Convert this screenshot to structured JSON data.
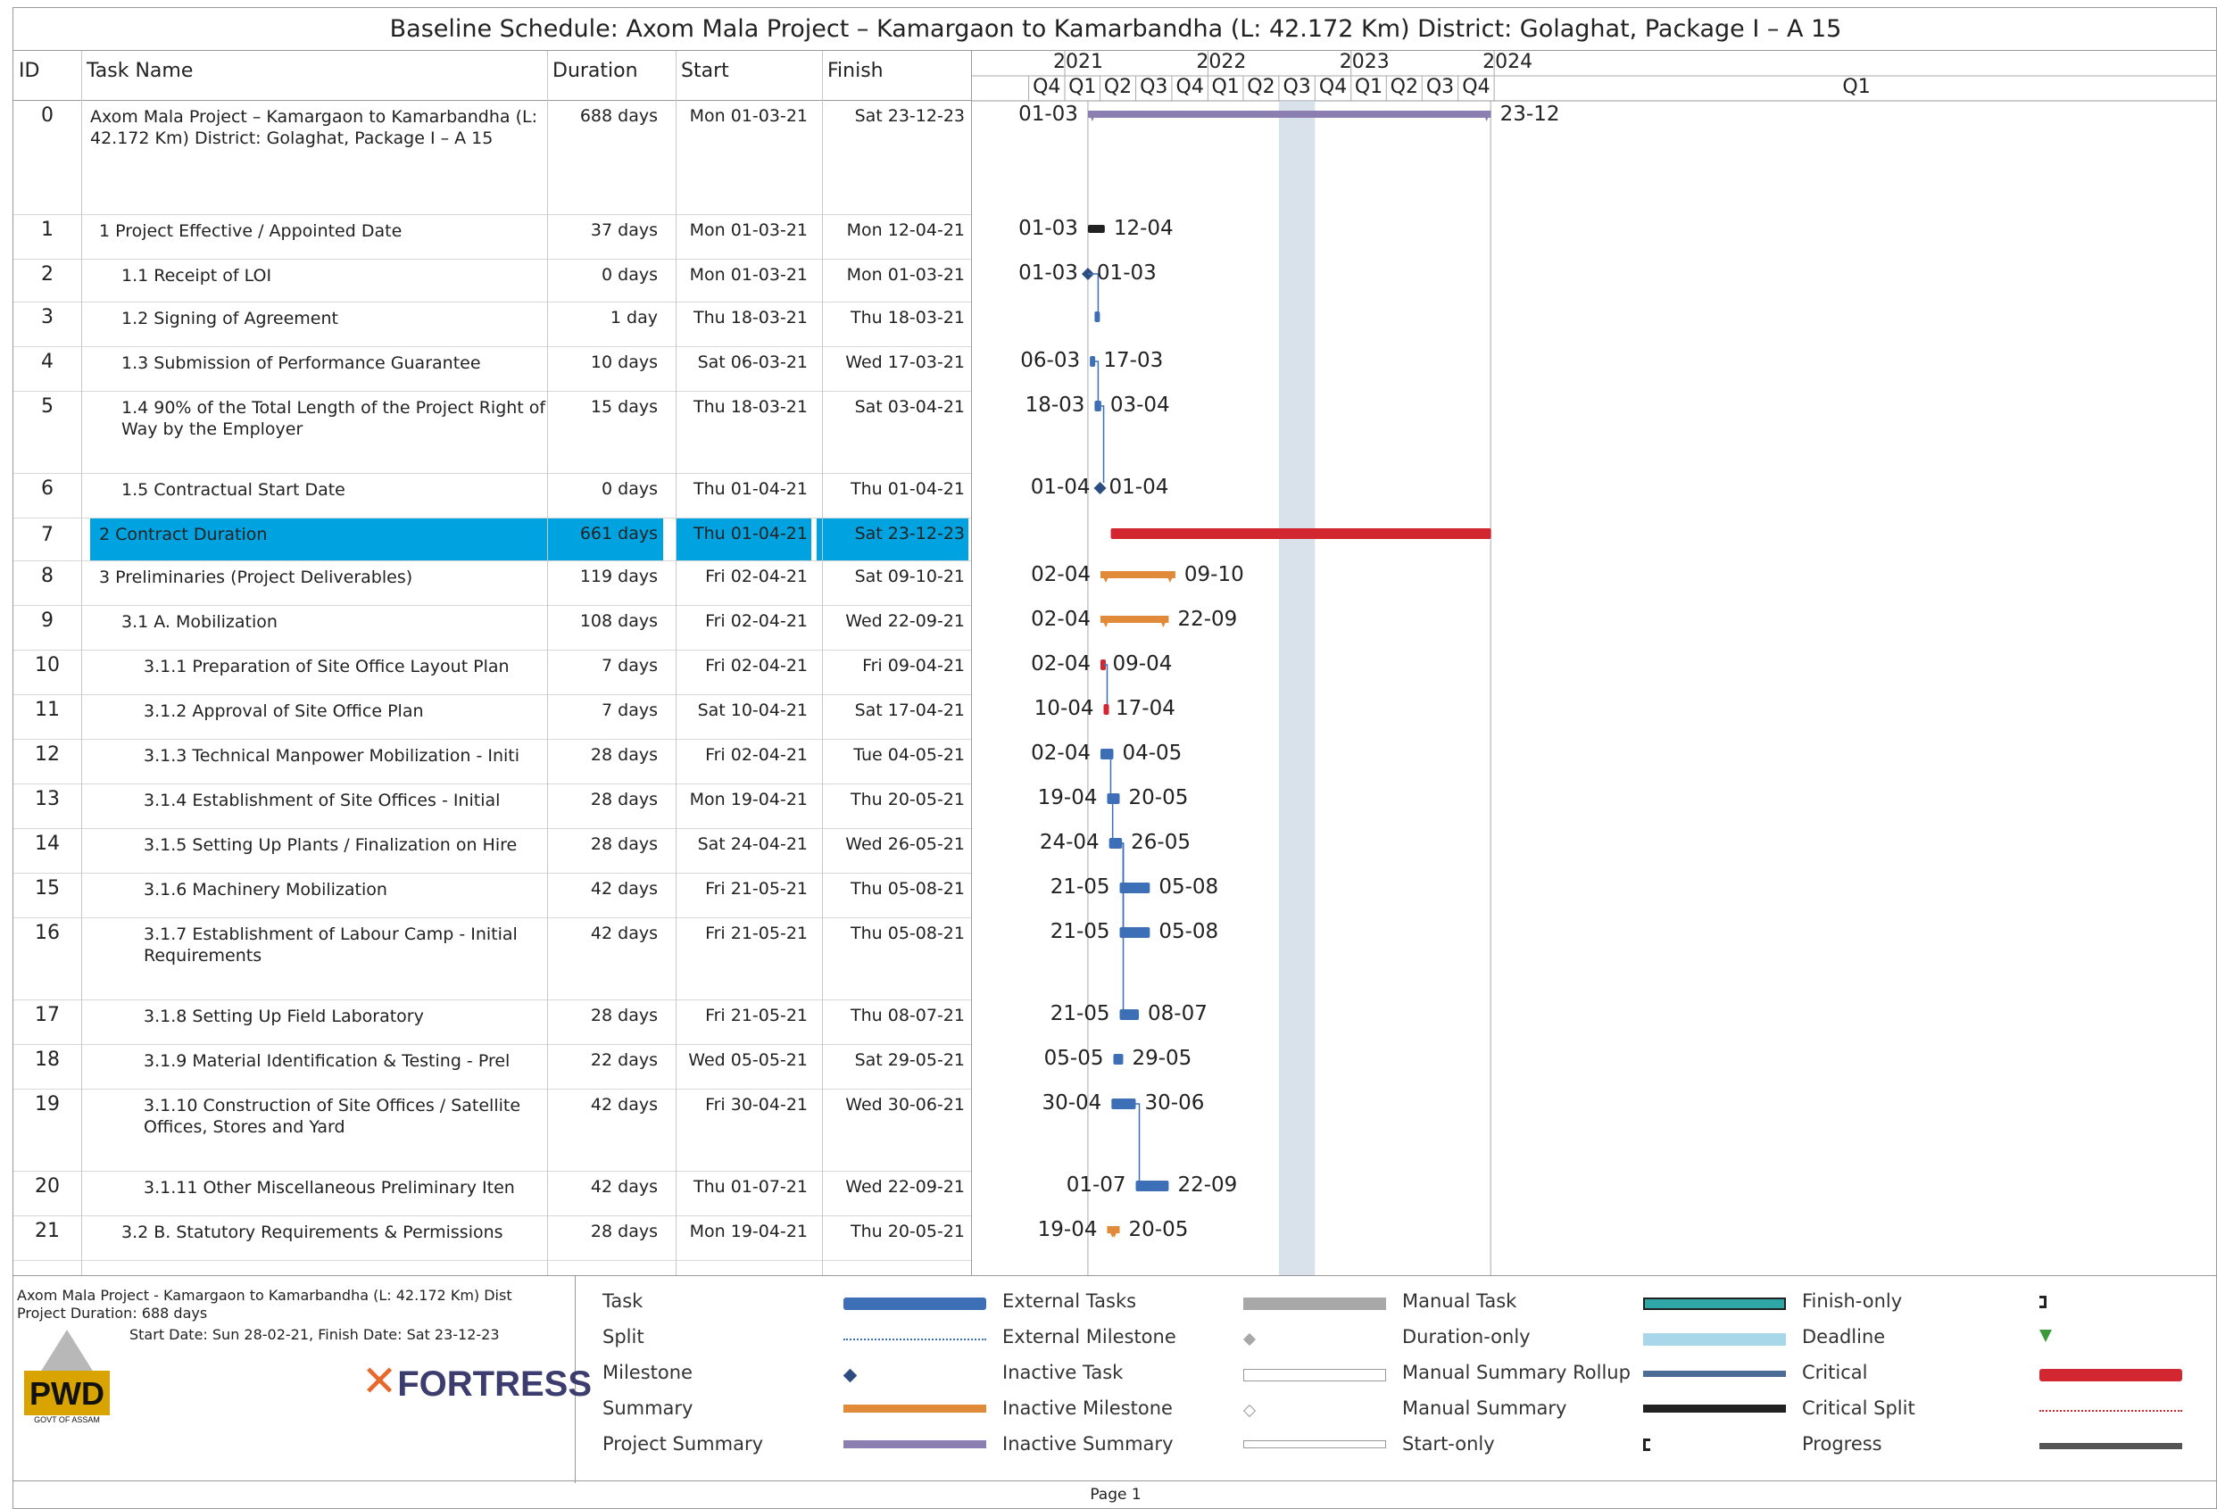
{
  "title": "Baseline Schedule: Axom Mala Project – Kamargaon to Kamarbandha (L: 42.172 Km) District: Golaghat, Package I – A 15",
  "columns": {
    "id": "ID",
    "name": "Task Name",
    "duration": "Duration",
    "start": "Start",
    "finish": "Finish"
  },
  "timescale": {
    "years": [
      "2021",
      "2022",
      "2023",
      "2024"
    ],
    "quarters": [
      "Q4",
      "Q1",
      "Q2",
      "Q3",
      "Q4",
      "Q1",
      "Q2",
      "Q3",
      "Q4",
      "Q1",
      "Q2",
      "Q3",
      "Q4",
      "Q1"
    ]
  },
  "tasks": [
    {
      "id": "0",
      "name": "Axom Mala Project – Kamargaon to Kamarbandha (L: 42.172 Km) District: Golaghat, Package I – A 15",
      "duration": "688 days",
      "start": "Mon 01-03-21",
      "finish": "Sat 23-12-23",
      "type": "project-summary",
      "label_start": "01-03",
      "label_finish": "23-12"
    },
    {
      "id": "1",
      "name": "1 Project Effective / Appointed Date",
      "duration": "37 days",
      "start": "Mon 01-03-21",
      "finish": "Mon 12-04-21",
      "type": "manual-summary",
      "label_start": "01-03",
      "label_finish": "12-04"
    },
    {
      "id": "2",
      "name": "1.1 Receipt of LOI",
      "duration": "0 days",
      "start": "Mon 01-03-21",
      "finish": "Mon 01-03-21",
      "type": "milestone",
      "label_start": "01-03",
      "label_finish": "01-03"
    },
    {
      "id": "3",
      "name": "1.2 Signing of Agreement",
      "duration": "1 day",
      "start": "Thu 18-03-21",
      "finish": "Thu 18-03-21",
      "type": "task",
      "label_start": "",
      "label_finish": ""
    },
    {
      "id": "4",
      "name": "1.3 Submission of Performance Guarantee",
      "duration": "10 days",
      "start": "Sat 06-03-21",
      "finish": "Wed 17-03-21",
      "type": "task",
      "label_start": "06-03",
      "label_finish": "17-03"
    },
    {
      "id": "5",
      "name": "1.4 90% of the Total Length of the Project Right of Way by the Employer",
      "duration": "15 days",
      "start": "Thu 18-03-21",
      "finish": "Sat 03-04-21",
      "type": "task",
      "label_start": "18-03",
      "label_finish": "03-04"
    },
    {
      "id": "6",
      "name": "1.5 Contractual Start Date",
      "duration": "0 days",
      "start": "Thu 01-04-21",
      "finish": "Thu 01-04-21",
      "type": "milestone",
      "label_start": "01-04",
      "label_finish": "01-04"
    },
    {
      "id": "7",
      "name": "2 Contract Duration",
      "duration": "661 days",
      "start": "Thu 01-04-21",
      "finish": "Sat 23-12-23",
      "type": "critical",
      "label_start": "",
      "label_finish": ""
    },
    {
      "id": "8",
      "name": "3 Preliminaries (Project Deliverables)",
      "duration": "119 days",
      "start": "Fri 02-04-21",
      "finish": "Sat 09-10-21",
      "type": "summary",
      "label_start": "02-04",
      "label_finish": "09-10"
    },
    {
      "id": "9",
      "name": "3.1 A. Mobilization",
      "duration": "108 days",
      "start": "Fri 02-04-21",
      "finish": "Wed 22-09-21",
      "type": "summary",
      "label_start": "02-04",
      "label_finish": "22-09"
    },
    {
      "id": "10",
      "name": "3.1.1 Preparation of Site Office Layout Plan",
      "duration": "7 days",
      "start": "Fri 02-04-21",
      "finish": "Fri 09-04-21",
      "type": "critical-task",
      "label_start": "02-04",
      "label_finish": "09-04"
    },
    {
      "id": "11",
      "name": "3.1.2 Approval of Site Office Plan",
      "duration": "7 days",
      "start": "Sat 10-04-21",
      "finish": "Sat 17-04-21",
      "type": "critical-task",
      "label_start": "10-04",
      "label_finish": "17-04"
    },
    {
      "id": "12",
      "name": "3.1.3 Technical Manpower Mobilization - Initi",
      "duration": "28 days",
      "start": "Fri 02-04-21",
      "finish": "Tue 04-05-21",
      "type": "task",
      "label_start": "02-04",
      "label_finish": "04-05"
    },
    {
      "id": "13",
      "name": "3.1.4 Establishment of Site Offices - Initial",
      "duration": "28 days",
      "start": "Mon 19-04-21",
      "finish": "Thu 20-05-21",
      "type": "task",
      "label_start": "19-04",
      "label_finish": "20-05"
    },
    {
      "id": "14",
      "name": "3.1.5 Setting Up Plants / Finalization on Hire",
      "duration": "28 days",
      "start": "Sat 24-04-21",
      "finish": "Wed 26-05-21",
      "type": "task",
      "label_start": "24-04",
      "label_finish": "26-05"
    },
    {
      "id": "15",
      "name": "3.1.6 Machinery Mobilization",
      "duration": "42 days",
      "start": "Fri 21-05-21",
      "finish": "Thu 05-08-21",
      "type": "task",
      "label_start": "21-05",
      "label_finish": "05-08"
    },
    {
      "id": "16",
      "name": "3.1.7 Establishment of Labour Camp - Initial Requirements",
      "duration": "42 days",
      "start": "Fri 21-05-21",
      "finish": "Thu 05-08-21",
      "type": "task",
      "label_start": "21-05",
      "label_finish": "05-08"
    },
    {
      "id": "17",
      "name": "3.1.8 Setting Up Field Laboratory",
      "duration": "28 days",
      "start": "Fri 21-05-21",
      "finish": "Thu 08-07-21",
      "type": "task",
      "label_start": "21-05",
      "label_finish": "08-07"
    },
    {
      "id": "18",
      "name": "3.1.9 Material Identification & Testing - Prel",
      "duration": "22 days",
      "start": "Wed 05-05-21",
      "finish": "Sat 29-05-21",
      "type": "task",
      "label_start": "05-05",
      "label_finish": "29-05"
    },
    {
      "id": "19",
      "name": "3.1.10 Construction of Site Offices / Satellite Offices, Stores and Yard",
      "duration": "42 days",
      "start": "Fri 30-04-21",
      "finish": "Wed 30-06-21",
      "type": "task",
      "label_start": "30-04",
      "label_finish": "30-06"
    },
    {
      "id": "20",
      "name": "3.1.11 Other Miscellaneous Preliminary Iten",
      "duration": "42 days",
      "start": "Thu 01-07-21",
      "finish": "Wed 22-09-21",
      "type": "task",
      "label_start": "01-07",
      "label_finish": "22-09"
    },
    {
      "id": "21",
      "name": "3.2 B. Statutory Requirements & Permissions",
      "duration": "28 days",
      "start": "Mon 19-04-21",
      "finish": "Thu 20-05-21",
      "type": "summary",
      "label_start": "19-04",
      "label_finish": "20-05"
    }
  ],
  "info": {
    "project_line": "Axom Mala Project - Kamargaon to Kamarbandha (L: 42.172 Km) Dist",
    "duration_line": "Project Duration: 688 days",
    "dates_line": "Start Date: Sun 28-02-21,  Finish Date: Sat 23-12-23",
    "pwd_logo": "PWD",
    "pwd_sub": "GOVT OF ASSAM",
    "fortress_logo": "FORTRESS"
  },
  "legend": [
    {
      "label": "Task",
      "swatch": "task"
    },
    {
      "label": "Split",
      "swatch": "split"
    },
    {
      "label": "Milestone",
      "swatch": "milestone"
    },
    {
      "label": "Summary",
      "swatch": "summary"
    },
    {
      "label": "Project Summary",
      "swatch": "project-summary"
    },
    {
      "label": "External Tasks",
      "swatch": "external-task"
    },
    {
      "label": "External Milestone",
      "swatch": "external-milestone"
    },
    {
      "label": "Inactive Task",
      "swatch": "inactive-task"
    },
    {
      "label": "Inactive Milestone",
      "swatch": "inactive-milestone"
    },
    {
      "label": "Inactive Summary",
      "swatch": "inactive-summary"
    },
    {
      "label": "Manual Task",
      "swatch": "manual-task"
    },
    {
      "label": "Duration-only",
      "swatch": "duration-only"
    },
    {
      "label": "Manual Summary Rollup",
      "swatch": "manual-summary-rollup"
    },
    {
      "label": "Manual Summary",
      "swatch": "manual-summary"
    },
    {
      "label": "Start-only",
      "swatch": "start-only"
    },
    {
      "label": "Finish-only",
      "swatch": "finish-only"
    },
    {
      "label": "Deadline",
      "swatch": "deadline"
    },
    {
      "label": "Critical",
      "swatch": "critical"
    },
    {
      "label": "Critical Split",
      "swatch": "critical-split"
    },
    {
      "label": "Progress",
      "swatch": "progress"
    }
  ],
  "colors": {
    "task": "#3d6fb6",
    "summary": "#e08a3a",
    "project_summary": "#8a7fb0",
    "critical": "#d22630",
    "highlight": "#00a3e0",
    "manual_task": "#2fa7a7",
    "shade": "#c9d6e3"
  },
  "footer": {
    "page": "Page 1"
  }
}
